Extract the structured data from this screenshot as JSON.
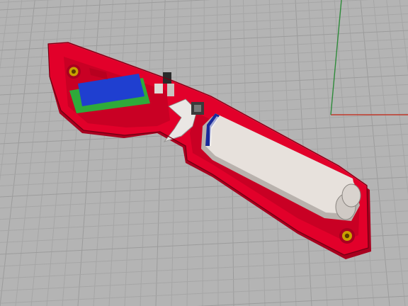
{
  "viewport": {
    "background_color": "#b4b4b4",
    "grid_line_color": "#a6a6a6",
    "grid_major_color": "#9c9c9c",
    "axis_x_color": "#c0392b",
    "axis_y_color": "#2e8b3a"
  },
  "model": {
    "housing_color": "#e2002a",
    "housing_shadow_color": "#a8001f",
    "housing_inner_color": "#c90024",
    "pcb_color": "#2faa3a",
    "display_color": "#1f3fd0",
    "battery_color": "#e7e1dc",
    "battery_shadow_color": "#b9b2ad",
    "blade_color": "#eae7e4",
    "screw_boss_color": "#c8a000",
    "switch_color": "#2a2a2a"
  }
}
